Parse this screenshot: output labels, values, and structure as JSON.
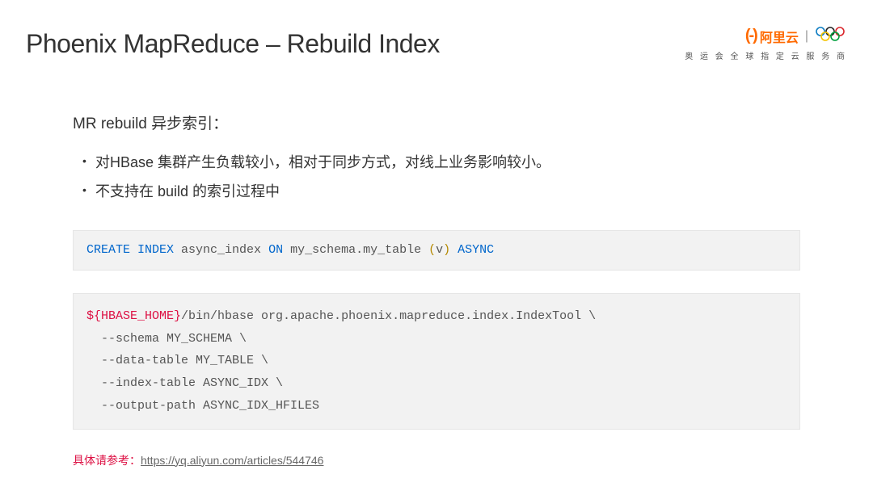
{
  "header": {
    "title": "Phoenix MapReduce – Rebuild Index",
    "logo": {
      "bracket": "(-)",
      "brand": "阿里云",
      "divider": "|",
      "tagline": "奥 运 会 全 球 指 定 云 服 务 商"
    }
  },
  "body": {
    "intro": "MR rebuild 异步索引：",
    "bullets": [
      "对HBase 集群产生负载较小，相对于同步方式，对线上业务影响较小。",
      "不支持在 build 的索引过程中"
    ],
    "sql": {
      "kw_create": "CREATE INDEX",
      "idx_name": " async_index ",
      "kw_on": "ON",
      "schema": " my_schema",
      "dot": ".",
      "table": "my_table ",
      "lparen": "(",
      "col": "v",
      "rparen": ")",
      "kw_async": " ASYNC"
    },
    "shell": {
      "var": "${HBASE_HOME}",
      "line1_rest": "/bin/hbase org.apache.phoenix.mapreduce.index.IndexTool \\",
      "line2": "  --schema MY_SCHEMA \\",
      "line3": "  --data-table MY_TABLE \\",
      "line4": "  --index-table ASYNC_IDX \\",
      "line5": "  --output-path ASYNC_IDX_HFILES"
    },
    "ref": {
      "label": "具体请参考：",
      "url": "https://yq.aliyun.com/articles/544746"
    }
  }
}
